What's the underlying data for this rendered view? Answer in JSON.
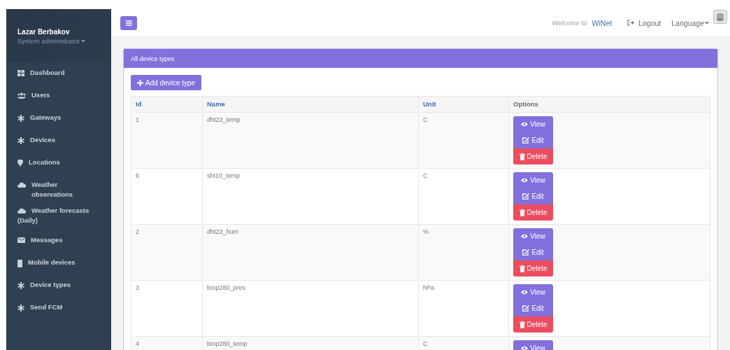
{
  "sidebar": {
    "user": {
      "name": "Lazar Berbakov",
      "role": "System administrator"
    },
    "items": [
      "Dashboard",
      "Users",
      "Gateways",
      "Devices",
      "Locations",
      "Weather observations",
      "Weather forecasts (Daily)",
      "Messages",
      "Mobile devices",
      "Device types",
      "Send FCM"
    ]
  },
  "topbar": {
    "welcome": "Welcome to",
    "brand": "WiNet",
    "logout": "Logout",
    "language": "Language"
  },
  "panel": {
    "title": "All device types",
    "add_button": "Add device type",
    "columns": [
      "Id",
      "Name",
      "Unit",
      "Options"
    ],
    "rows": [
      {
        "id": "1",
        "name": "dht22_temp",
        "unit": "C",
        "actions": [
          "View",
          "Edit",
          "Delete"
        ]
      },
      {
        "id": "6",
        "name": "sht10_temp",
        "unit": "C",
        "actions": [
          "View",
          "Edit",
          "Delete"
        ]
      },
      {
        "id": "2",
        "name": "dht22_hum",
        "unit": "%",
        "actions": [
          "View",
          "Edit",
          "Delete"
        ]
      },
      {
        "id": "3",
        "name": "bmp280_pres",
        "unit": "hPa",
        "actions": [
          "View",
          "Edit",
          "Delete"
        ]
      },
      {
        "id": "4",
        "name": "bmp280_temp",
        "unit": "C",
        "actions": [
          "View"
        ]
      }
    ]
  }
}
